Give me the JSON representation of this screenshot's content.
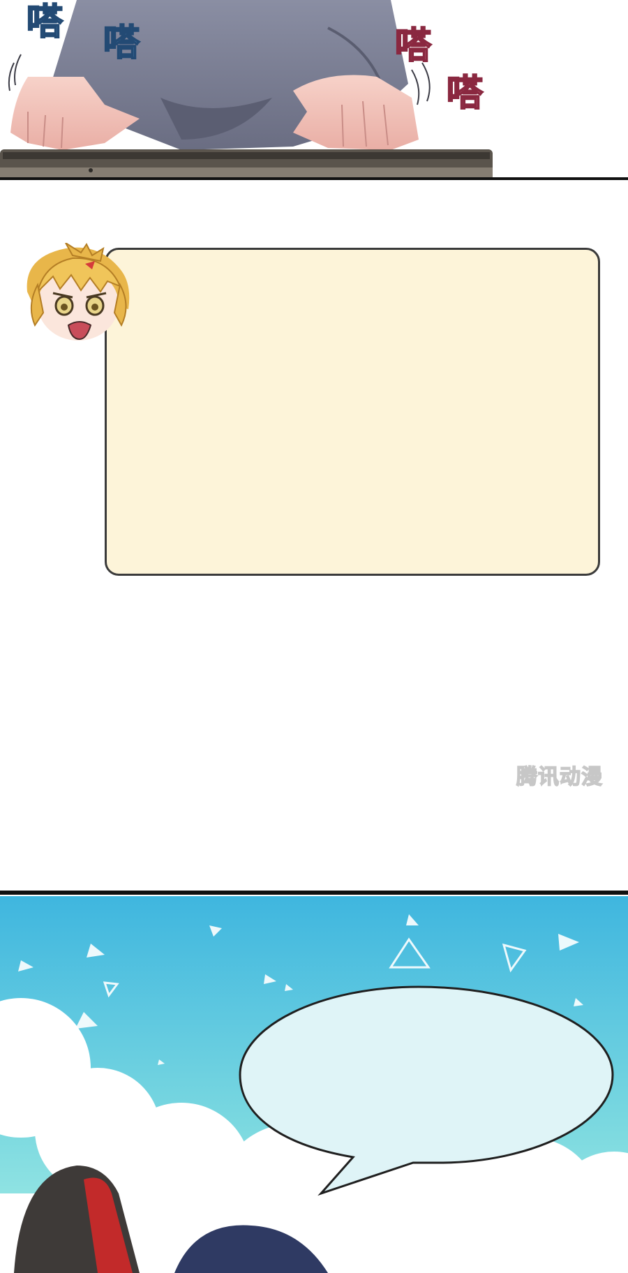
{
  "panels": {
    "top": {
      "sfx": [
        {
          "text": "嗒",
          "tone": "blue"
        },
        {
          "text": "嗒",
          "tone": "blue"
        },
        {
          "text": "嗒",
          "tone": "pink"
        },
        {
          "text": "嗒",
          "tone": "pink"
        }
      ]
    },
    "middle": {
      "speech_box_text": "",
      "watermark": "腾讯动漫"
    },
    "bottom": {
      "speech_bubble_text": ""
    }
  },
  "colors": {
    "sky_top": "#3fb6df",
    "sky_bottom": "#a6eee4",
    "speech_box_fill": "#fdf4d9",
    "bubble_fill": "#dff4f7",
    "hair_blond": "#e8b64a",
    "sleeve_gray": "#7b7f93"
  }
}
